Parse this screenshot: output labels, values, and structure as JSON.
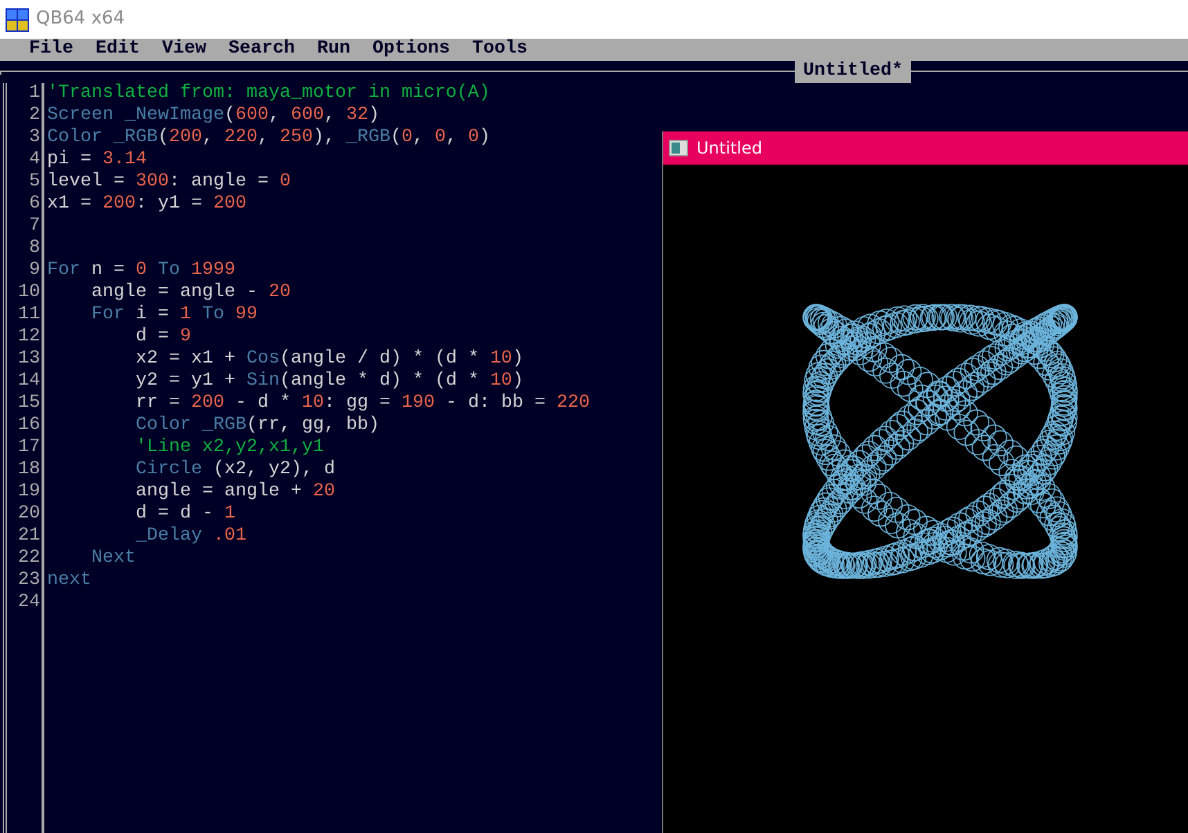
{
  "window": {
    "title": "QB64 x64"
  },
  "menu": [
    "File",
    "Edit",
    "View",
    "Search",
    "Run",
    "Options",
    "Tools"
  ],
  "editor": {
    "tab_title": "Untitled*",
    "lines": [
      {
        "number": "1",
        "tokens": [
          {
            "kind": "comment",
            "text": "'Translated from: maya_motor in micro(A)"
          }
        ]
      },
      {
        "number": "2",
        "tokens": [
          {
            "kind": "keyword",
            "text": "Screen _NewImage"
          },
          {
            "kind": "text",
            "text": "("
          },
          {
            "kind": "number",
            "text": "600"
          },
          {
            "kind": "text",
            "text": ", "
          },
          {
            "kind": "number",
            "text": "600"
          },
          {
            "kind": "text",
            "text": ", "
          },
          {
            "kind": "number",
            "text": "32"
          },
          {
            "kind": "text",
            "text": ")"
          }
        ]
      },
      {
        "number": "3",
        "tokens": [
          {
            "kind": "keyword",
            "text": "Color _RGB"
          },
          {
            "kind": "text",
            "text": "("
          },
          {
            "kind": "number",
            "text": "200"
          },
          {
            "kind": "text",
            "text": ", "
          },
          {
            "kind": "number",
            "text": "220"
          },
          {
            "kind": "text",
            "text": ", "
          },
          {
            "kind": "number",
            "text": "250"
          },
          {
            "kind": "text",
            "text": "), "
          },
          {
            "kind": "keyword",
            "text": "_RGB"
          },
          {
            "kind": "text",
            "text": "("
          },
          {
            "kind": "number",
            "text": "0"
          },
          {
            "kind": "text",
            "text": ", "
          },
          {
            "kind": "number",
            "text": "0"
          },
          {
            "kind": "text",
            "text": ", "
          },
          {
            "kind": "number",
            "text": "0"
          },
          {
            "kind": "text",
            "text": ")"
          }
        ]
      },
      {
        "number": "4",
        "tokens": [
          {
            "kind": "text",
            "text": "pi = "
          },
          {
            "kind": "number",
            "text": "3.14"
          }
        ]
      },
      {
        "number": "5",
        "tokens": [
          {
            "kind": "text",
            "text": "level = "
          },
          {
            "kind": "number",
            "text": "300"
          },
          {
            "kind": "text",
            "text": ": angle = "
          },
          {
            "kind": "number",
            "text": "0"
          }
        ]
      },
      {
        "number": "6",
        "tokens": [
          {
            "kind": "text",
            "text": "x1 = "
          },
          {
            "kind": "number",
            "text": "200"
          },
          {
            "kind": "text",
            "text": ": y1 = "
          },
          {
            "kind": "number",
            "text": "200"
          }
        ]
      },
      {
        "number": "7"
      },
      {
        "number": "8"
      },
      {
        "number": "9",
        "tokens": [
          {
            "kind": "keyword",
            "text": "For"
          },
          {
            "kind": "text",
            "text": " n = "
          },
          {
            "kind": "number",
            "text": "0"
          },
          {
            "kind": "keyword",
            "text": " To "
          },
          {
            "kind": "number",
            "text": "1999"
          }
        ]
      },
      {
        "number": "10",
        "tokens": [
          {
            "kind": "text",
            "text": "    angle = angle - "
          },
          {
            "kind": "number",
            "text": "20"
          }
        ]
      },
      {
        "number": "11",
        "tokens": [
          {
            "kind": "keyword",
            "text": "    For"
          },
          {
            "kind": "text",
            "text": " i = "
          },
          {
            "kind": "number",
            "text": "1"
          },
          {
            "kind": "keyword",
            "text": " To "
          },
          {
            "kind": "number",
            "text": "99"
          }
        ]
      },
      {
        "number": "12",
        "tokens": [
          {
            "kind": "text",
            "text": "        d = "
          },
          {
            "kind": "number",
            "text": "9"
          }
        ]
      },
      {
        "number": "13",
        "tokens": [
          {
            "kind": "text",
            "text": "        x2 = x1 + "
          },
          {
            "kind": "keyword",
            "text": "Cos"
          },
          {
            "kind": "text",
            "text": "(angle / d) * (d * "
          },
          {
            "kind": "number",
            "text": "10"
          },
          {
            "kind": "text",
            "text": ")"
          }
        ]
      },
      {
        "number": "14",
        "tokens": [
          {
            "kind": "text",
            "text": "        y2 = y1 + "
          },
          {
            "kind": "keyword",
            "text": "Sin"
          },
          {
            "kind": "text",
            "text": "(angle * d) * (d * "
          },
          {
            "kind": "number",
            "text": "10"
          },
          {
            "kind": "text",
            "text": ")"
          }
        ]
      },
      {
        "number": "15",
        "tokens": [
          {
            "kind": "text",
            "text": "        rr = "
          },
          {
            "kind": "number",
            "text": "200"
          },
          {
            "kind": "text",
            "text": " - d * "
          },
          {
            "kind": "number",
            "text": "10"
          },
          {
            "kind": "text",
            "text": ": gg = "
          },
          {
            "kind": "number",
            "text": "190"
          },
          {
            "kind": "text",
            "text": " - d: bb = "
          },
          {
            "kind": "number",
            "text": "220"
          }
        ]
      },
      {
        "number": "16",
        "tokens": [
          {
            "kind": "keyword",
            "text": "        Color _RGB"
          },
          {
            "kind": "text",
            "text": "(rr, gg, bb)"
          }
        ]
      },
      {
        "number": "17",
        "tokens": [
          {
            "kind": "comment",
            "text": "        'Line x2,y2,x1,y1"
          }
        ]
      },
      {
        "number": "18",
        "tokens": [
          {
            "kind": "keyword",
            "text": "        Circle"
          },
          {
            "kind": "text",
            "text": " (x2, y2), d"
          }
        ]
      },
      {
        "number": "19",
        "tokens": [
          {
            "kind": "text",
            "text": "        angle = angle + "
          },
          {
            "kind": "number",
            "text": "20"
          }
        ]
      },
      {
        "number": "20",
        "tokens": [
          {
            "kind": "text",
            "text": "        d = d - "
          },
          {
            "kind": "number",
            "text": "1"
          }
        ]
      },
      {
        "number": "21",
        "tokens": [
          {
            "kind": "keyword",
            "text": "        _Delay"
          },
          {
            "kind": "number",
            "text": " .01"
          }
        ]
      },
      {
        "number": "22",
        "tokens": [
          {
            "kind": "keyword",
            "text": "    Next"
          }
        ]
      },
      {
        "number": "23",
        "tokens": [
          {
            "kind": "keyword",
            "text": "next"
          }
        ]
      },
      {
        "number": "24"
      }
    ]
  },
  "output_window": {
    "title": "Untitled"
  }
}
